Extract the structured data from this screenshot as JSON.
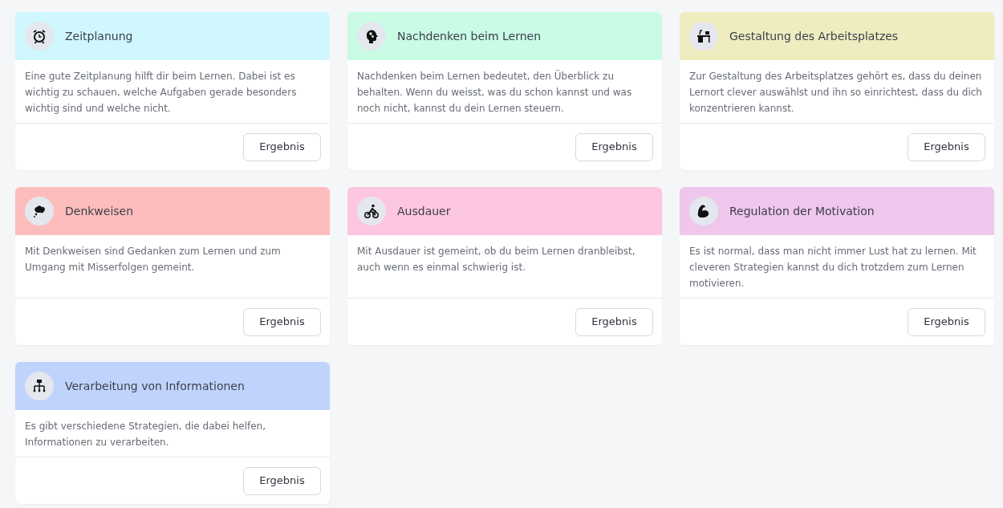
{
  "cards": [
    {
      "title": "Zeitplanung",
      "color": "#cff7fd",
      "text": "Eine gute Zeitplanung hilft dir beim Lernen. Dabei ist es wichtig zu schauen, welche Aufgaben gerade besonders wichtig sind und welche nicht.",
      "button": "Ergebnis"
    },
    {
      "title": "Nachdenken beim Lernen",
      "color": "#c9fbe5",
      "text": "Nachdenken beim Lernen bedeutet, den Überblick zu behalten. Wenn du weisst, was du schon kannst und was noch nicht, kannst du dein Lernen steuern.",
      "button": "Ergebnis"
    },
    {
      "title": "Gestaltung des Arbeitsplatzes",
      "color": "#efedc0",
      "text": "Zur Gestaltung des Arbeitsplatzes gehört es, dass du deinen Lernort clever auswählst und ihn so einrichtest, dass du dich konzentrieren kannst.",
      "button": "Ergebnis"
    },
    {
      "title": "Denkweisen",
      "color": "#fdbdbd",
      "text": "Mit Denkweisen sind Gedanken zum Lernen und zum Umgang mit Misserfolgen gemeint.",
      "button": "Ergebnis"
    },
    {
      "title": "Ausdauer",
      "color": "#fdc6e1",
      "text": "Mit Ausdauer ist gemeint, ob du beim Lernen dranbleibst, auch wenn es einmal schwierig ist.",
      "button": "Ergebnis"
    },
    {
      "title": "Regulation der Motivation",
      "color": "#efc7ec",
      "text": "Es ist normal, dass man nicht immer Lust hat zu lernen. Mit cleveren Strategien kannst du dich trotzdem zum Lernen motivieren.",
      "button": "Ergebnis"
    },
    {
      "title": "Verarbeitung von Informationen",
      "color": "#c0d3fc",
      "text": "Es gibt verschiedene Strategien, die dabei helfen, Informationen zu verarbeiten.",
      "button": "Ergebnis"
    }
  ]
}
